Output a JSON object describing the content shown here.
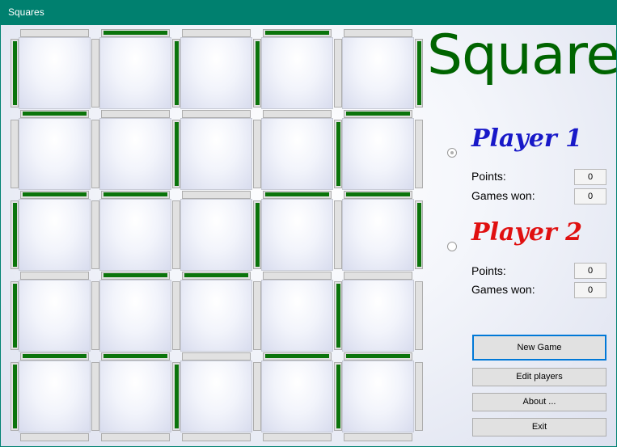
{
  "window": {
    "title": "Squares"
  },
  "logo": {
    "text": "Squares"
  },
  "players": [
    {
      "name": "Player 1",
      "color": "#1818c8",
      "points_label": "Points:",
      "points": "0",
      "games_label": "Games won:",
      "games_won": "0",
      "selected": true
    },
    {
      "name": "Player 2",
      "color": "#e01010",
      "points_label": "Points:",
      "points": "0",
      "games_label": "Games won:",
      "games_won": "0",
      "selected": false
    }
  ],
  "buttons": {
    "new_game": "New Game",
    "edit_players": "Edit players",
    "about": "About ...",
    "exit": "Exit"
  },
  "board": {
    "rows": 5,
    "cols": 5,
    "line_color": "#0b740b",
    "horizontal_taken": [
      [
        0,
        1,
        0,
        1,
        0
      ],
      [
        1,
        0,
        0,
        0,
        1
      ],
      [
        1,
        1,
        0,
        1,
        1
      ],
      [
        0,
        1,
        1,
        0,
        0
      ],
      [
        1,
        1,
        0,
        1,
        1
      ],
      [
        0,
        0,
        0,
        0,
        0
      ]
    ],
    "vertical_taken": [
      [
        1,
        0,
        1,
        1,
        0,
        1
      ],
      [
        0,
        0,
        1,
        0,
        1,
        0
      ],
      [
        1,
        0,
        0,
        1,
        0,
        1
      ],
      [
        1,
        0,
        0,
        0,
        1,
        0
      ],
      [
        1,
        0,
        1,
        0,
        1,
        0
      ]
    ]
  }
}
